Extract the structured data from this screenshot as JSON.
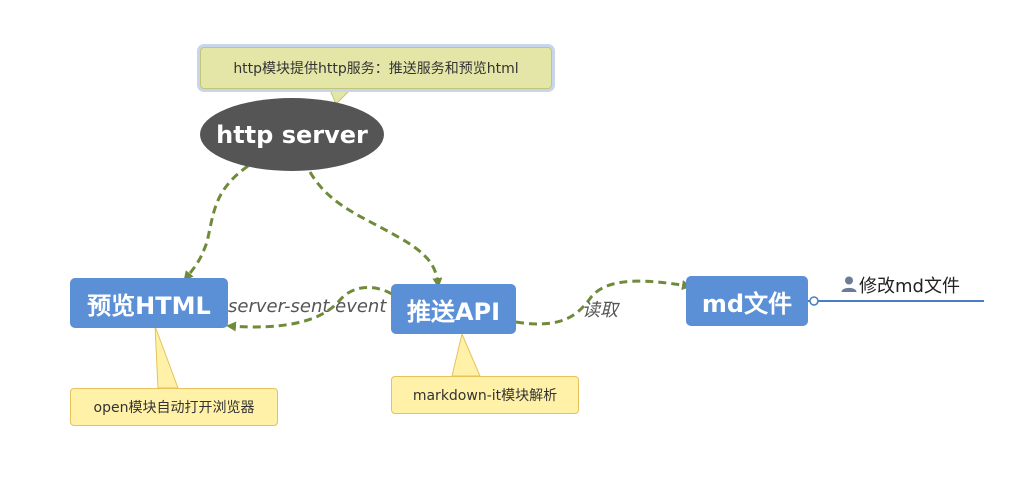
{
  "nodes": {
    "http_server": "http server",
    "preview_html": "预览HTML",
    "push_api": "推送API",
    "md_file": "md文件"
  },
  "notes": {
    "http_server": "http模块提供http服务：推送服务和预览html",
    "preview_html": "open模块自动打开浏览器",
    "push_api": "markdown-it模块解析"
  },
  "edge_labels": {
    "sse": "server-sent event",
    "read": "读取"
  },
  "subtopic": {
    "label": "修改md文件",
    "icon": "user-icon"
  },
  "colors": {
    "node_blue": "#5b8fd6",
    "ellipse_gray": "#555555",
    "edge_green": "#6f8b3a",
    "note_yellow": "#fff1a8",
    "note_olive": "#e4e6a8",
    "branch_line": "#4a7dc4"
  }
}
